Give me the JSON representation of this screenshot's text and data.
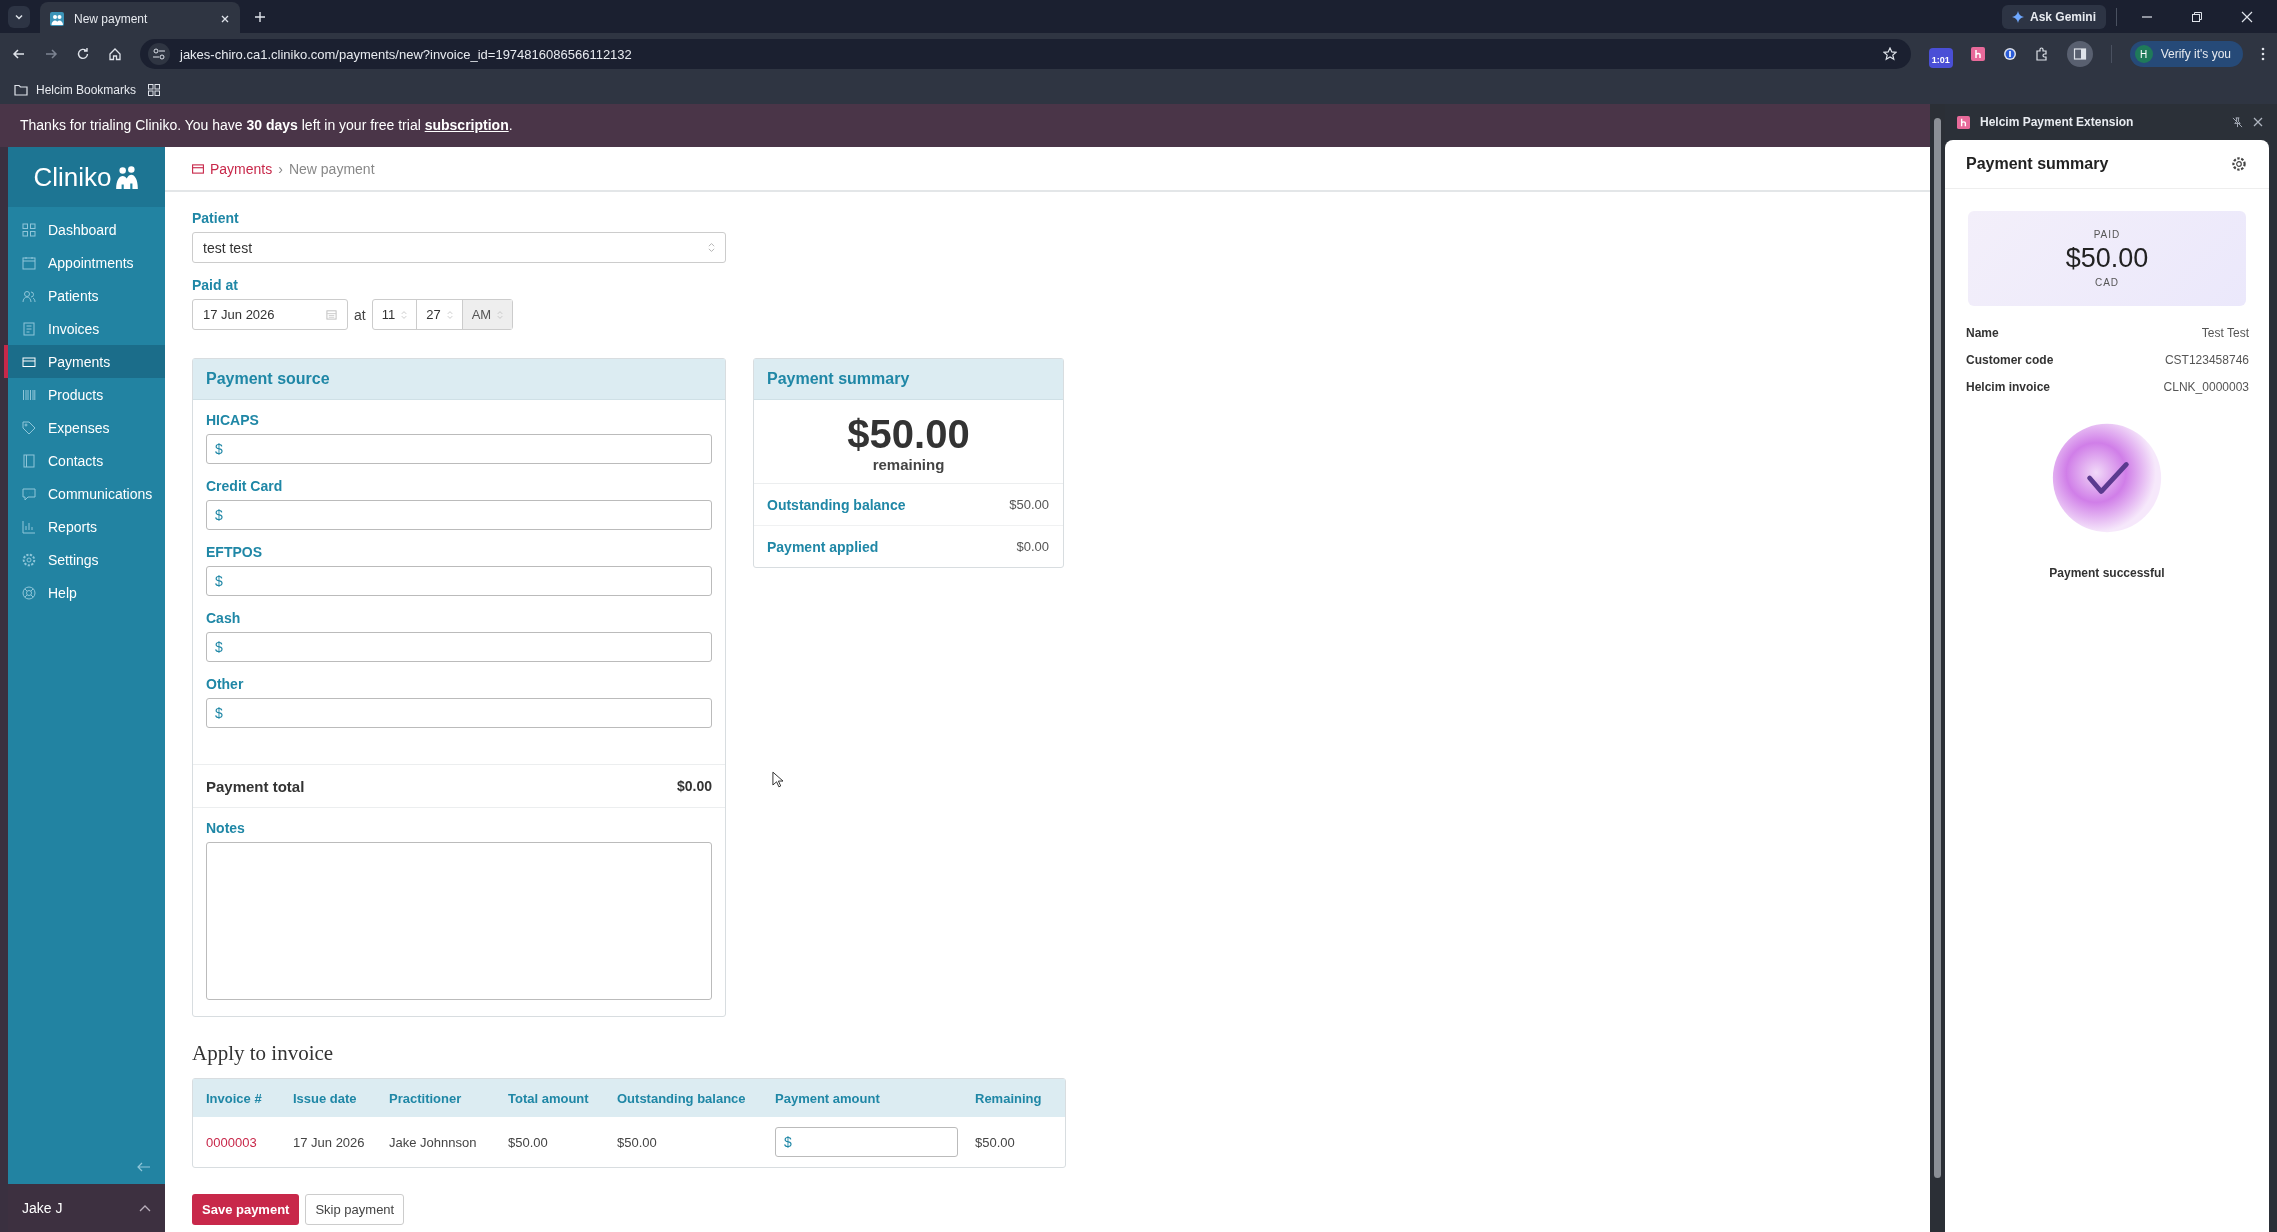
{
  "browser": {
    "tab_title": "New payment",
    "url": "jakes-chiro.ca1.cliniko.com/payments/new?invoice_id=1974816086566112132",
    "ask_gemini": "Ask Gemini",
    "extension_badge": "1:01",
    "profile_initial": "H",
    "profile_button": "Verify it's you",
    "bookmarks": [
      {
        "label": "Helcim Bookmarks"
      }
    ]
  },
  "banner": {
    "text": "Thanks for trialing Cliniko. You have **30 days** left in your free trial",
    "link": "subscription",
    "end": "."
  },
  "sidebar": {
    "logo": "Cliniko",
    "items": [
      {
        "label": "Dashboard",
        "selected": false
      },
      {
        "label": "Appointments",
        "selected": false
      },
      {
        "label": "Patients",
        "selected": false
      },
      {
        "label": "Invoices",
        "selected": false
      },
      {
        "label": "Payments",
        "selected": true
      },
      {
        "label": "Products",
        "selected": false
      },
      {
        "label": "Expenses",
        "selected": false
      },
      {
        "label": "Contacts",
        "selected": false
      },
      {
        "label": "Communications",
        "selected": false
      },
      {
        "label": "Reports",
        "selected": false
      },
      {
        "label": "Settings",
        "selected": false
      },
      {
        "label": "Help",
        "selected": false
      }
    ],
    "user": "Jake J"
  },
  "breadcrumb": {
    "parent": "Payments",
    "separator": "›",
    "current": "New payment"
  },
  "form": {
    "patient_label": "Patient",
    "patient_value": "test test",
    "paid_at_label": "Paid at",
    "date": "17 Jun 2026",
    "at": "at",
    "hour": "11",
    "minute": "27",
    "meridiem": "AM"
  },
  "payment_source": {
    "title": "Payment source",
    "fields": [
      {
        "label": "HICAPS",
        "prefix": "$"
      },
      {
        "label": "Credit Card",
        "prefix": "$"
      },
      {
        "label": "EFTPOS",
        "prefix": "$"
      },
      {
        "label": "Cash",
        "prefix": "$"
      },
      {
        "label": "Other",
        "prefix": "$"
      }
    ],
    "total_label": "Payment total",
    "total_value": "$0.00",
    "notes_label": "Notes"
  },
  "payment_summary": {
    "title": "Payment summary",
    "amount": "$50.00",
    "caption": "remaining",
    "rows": [
      {
        "label": "Outstanding balance",
        "value": "$50.00"
      },
      {
        "label": "Payment applied",
        "value": "$0.00"
      }
    ]
  },
  "apply_to_invoice": {
    "heading": "Apply to invoice",
    "columns": [
      "Invoice #",
      "Issue date",
      "Practitioner",
      "Total amount",
      "Outstanding balance",
      "Payment amount",
      "Remaining"
    ],
    "rows": [
      {
        "invoice": "0000003",
        "issue_date": "17 Jun 2026",
        "practitioner": "Jake Johnnson",
        "total": "$50.00",
        "outstanding": "$50.00",
        "payment_prefix": "$",
        "remaining": "$50.00"
      }
    ]
  },
  "buttons": {
    "save": "Save payment",
    "skip": "Skip payment"
  },
  "extension": {
    "title": "Helcim Payment Extension",
    "card_title": "Payment summary",
    "paid_label": "PAID",
    "amount": "$50.00",
    "currency": "CAD",
    "details": [
      {
        "label": "Name",
        "value": "Test Test"
      },
      {
        "label": "Customer code",
        "value": "CST123458746"
      },
      {
        "label": "Helcim invoice",
        "value": "CLNK_0000003"
      }
    ],
    "status": "Payment successful"
  }
}
